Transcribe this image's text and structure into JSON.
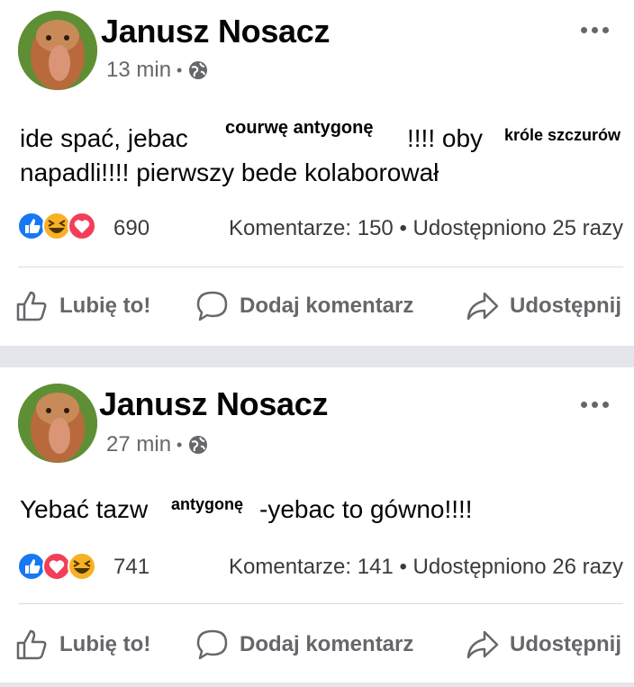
{
  "posts": [
    {
      "author": "Janusz Nosacz",
      "time": "13 min",
      "text_line1": "ide spać,  jebac ",
      "text_line1_mid": "!!!! oby ",
      "text_line2": "napadli!!!! pierwszy bede kolaborował",
      "overlay1": "courwę antygonę",
      "overlay2": "króle szczurów",
      "reaction_count": "690",
      "counts": "Komentarze: 150 • Udostępniono 25 razy"
    },
    {
      "author": "Janusz Nosacz",
      "time": "27 min",
      "text_line1": "Yebać tazw",
      "text_line1_mid": "-yebac to gówno!!!!",
      "overlay1": "antygonę",
      "reaction_count": "741",
      "counts": "Komentarze: 141 • Udostępniono 26 razy"
    }
  ],
  "actions": {
    "like": "Lubię to!",
    "comment": "Dodaj komentarz",
    "share": "Udostępnij"
  },
  "colors": {
    "like_blue": "#1877f2",
    "love_red": "#f33e58",
    "haha_yellow": "#f7b125",
    "muted": "#65676b"
  }
}
